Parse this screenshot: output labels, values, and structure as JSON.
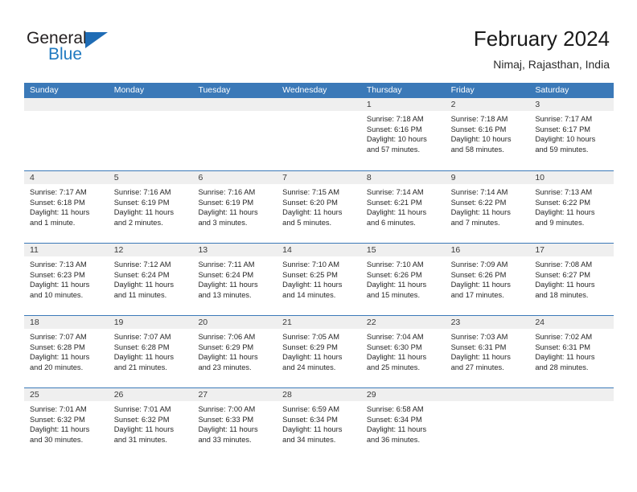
{
  "brand": {
    "line1": "General",
    "line2": "Blue",
    "triangle_color": "#1f6cb5",
    "blue_color": "#1f79c0"
  },
  "header": {
    "title": "February 2024",
    "location": "Nimaj, Rajasthan, India"
  },
  "theme": {
    "header_bg": "#3b79b8",
    "day_band_bg": "#efefef",
    "text": "#262626"
  },
  "calendar": {
    "weekday_headers": [
      "Sunday",
      "Monday",
      "Tuesday",
      "Wednesday",
      "Thursday",
      "Friday",
      "Saturday"
    ],
    "weeks": [
      [
        {
          "day": "",
          "empty": true
        },
        {
          "day": "",
          "empty": true
        },
        {
          "day": "",
          "empty": true
        },
        {
          "day": "",
          "empty": true
        },
        {
          "day": "1",
          "sunrise": "Sunrise: 7:18 AM",
          "sunset": "Sunset: 6:16 PM",
          "daylight1": "Daylight: 10 hours",
          "daylight2": "and 57 minutes."
        },
        {
          "day": "2",
          "sunrise": "Sunrise: 7:18 AM",
          "sunset": "Sunset: 6:16 PM",
          "daylight1": "Daylight: 10 hours",
          "daylight2": "and 58 minutes."
        },
        {
          "day": "3",
          "sunrise": "Sunrise: 7:17 AM",
          "sunset": "Sunset: 6:17 PM",
          "daylight1": "Daylight: 10 hours",
          "daylight2": "and 59 minutes."
        }
      ],
      [
        {
          "day": "4",
          "sunrise": "Sunrise: 7:17 AM",
          "sunset": "Sunset: 6:18 PM",
          "daylight1": "Daylight: 11 hours",
          "daylight2": "and 1 minute."
        },
        {
          "day": "5",
          "sunrise": "Sunrise: 7:16 AM",
          "sunset": "Sunset: 6:19 PM",
          "daylight1": "Daylight: 11 hours",
          "daylight2": "and 2 minutes."
        },
        {
          "day": "6",
          "sunrise": "Sunrise: 7:16 AM",
          "sunset": "Sunset: 6:19 PM",
          "daylight1": "Daylight: 11 hours",
          "daylight2": "and 3 minutes."
        },
        {
          "day": "7",
          "sunrise": "Sunrise: 7:15 AM",
          "sunset": "Sunset: 6:20 PM",
          "daylight1": "Daylight: 11 hours",
          "daylight2": "and 5 minutes."
        },
        {
          "day": "8",
          "sunrise": "Sunrise: 7:14 AM",
          "sunset": "Sunset: 6:21 PM",
          "daylight1": "Daylight: 11 hours",
          "daylight2": "and 6 minutes."
        },
        {
          "day": "9",
          "sunrise": "Sunrise: 7:14 AM",
          "sunset": "Sunset: 6:22 PM",
          "daylight1": "Daylight: 11 hours",
          "daylight2": "and 7 minutes."
        },
        {
          "day": "10",
          "sunrise": "Sunrise: 7:13 AM",
          "sunset": "Sunset: 6:22 PM",
          "daylight1": "Daylight: 11 hours",
          "daylight2": "and 9 minutes."
        }
      ],
      [
        {
          "day": "11",
          "sunrise": "Sunrise: 7:13 AM",
          "sunset": "Sunset: 6:23 PM",
          "daylight1": "Daylight: 11 hours",
          "daylight2": "and 10 minutes."
        },
        {
          "day": "12",
          "sunrise": "Sunrise: 7:12 AM",
          "sunset": "Sunset: 6:24 PM",
          "daylight1": "Daylight: 11 hours",
          "daylight2": "and 11 minutes."
        },
        {
          "day": "13",
          "sunrise": "Sunrise: 7:11 AM",
          "sunset": "Sunset: 6:24 PM",
          "daylight1": "Daylight: 11 hours",
          "daylight2": "and 13 minutes."
        },
        {
          "day": "14",
          "sunrise": "Sunrise: 7:10 AM",
          "sunset": "Sunset: 6:25 PM",
          "daylight1": "Daylight: 11 hours",
          "daylight2": "and 14 minutes."
        },
        {
          "day": "15",
          "sunrise": "Sunrise: 7:10 AM",
          "sunset": "Sunset: 6:26 PM",
          "daylight1": "Daylight: 11 hours",
          "daylight2": "and 15 minutes."
        },
        {
          "day": "16",
          "sunrise": "Sunrise: 7:09 AM",
          "sunset": "Sunset: 6:26 PM",
          "daylight1": "Daylight: 11 hours",
          "daylight2": "and 17 minutes."
        },
        {
          "day": "17",
          "sunrise": "Sunrise: 7:08 AM",
          "sunset": "Sunset: 6:27 PM",
          "daylight1": "Daylight: 11 hours",
          "daylight2": "and 18 minutes."
        }
      ],
      [
        {
          "day": "18",
          "sunrise": "Sunrise: 7:07 AM",
          "sunset": "Sunset: 6:28 PM",
          "daylight1": "Daylight: 11 hours",
          "daylight2": "and 20 minutes."
        },
        {
          "day": "19",
          "sunrise": "Sunrise: 7:07 AM",
          "sunset": "Sunset: 6:28 PM",
          "daylight1": "Daylight: 11 hours",
          "daylight2": "and 21 minutes."
        },
        {
          "day": "20",
          "sunrise": "Sunrise: 7:06 AM",
          "sunset": "Sunset: 6:29 PM",
          "daylight1": "Daylight: 11 hours",
          "daylight2": "and 23 minutes."
        },
        {
          "day": "21",
          "sunrise": "Sunrise: 7:05 AM",
          "sunset": "Sunset: 6:29 PM",
          "daylight1": "Daylight: 11 hours",
          "daylight2": "and 24 minutes."
        },
        {
          "day": "22",
          "sunrise": "Sunrise: 7:04 AM",
          "sunset": "Sunset: 6:30 PM",
          "daylight1": "Daylight: 11 hours",
          "daylight2": "and 25 minutes."
        },
        {
          "day": "23",
          "sunrise": "Sunrise: 7:03 AM",
          "sunset": "Sunset: 6:31 PM",
          "daylight1": "Daylight: 11 hours",
          "daylight2": "and 27 minutes."
        },
        {
          "day": "24",
          "sunrise": "Sunrise: 7:02 AM",
          "sunset": "Sunset: 6:31 PM",
          "daylight1": "Daylight: 11 hours",
          "daylight2": "and 28 minutes."
        }
      ],
      [
        {
          "day": "25",
          "sunrise": "Sunrise: 7:01 AM",
          "sunset": "Sunset: 6:32 PM",
          "daylight1": "Daylight: 11 hours",
          "daylight2": "and 30 minutes."
        },
        {
          "day": "26",
          "sunrise": "Sunrise: 7:01 AM",
          "sunset": "Sunset: 6:32 PM",
          "daylight1": "Daylight: 11 hours",
          "daylight2": "and 31 minutes."
        },
        {
          "day": "27",
          "sunrise": "Sunrise: 7:00 AM",
          "sunset": "Sunset: 6:33 PM",
          "daylight1": "Daylight: 11 hours",
          "daylight2": "and 33 minutes."
        },
        {
          "day": "28",
          "sunrise": "Sunrise: 6:59 AM",
          "sunset": "Sunset: 6:34 PM",
          "daylight1": "Daylight: 11 hours",
          "daylight2": "and 34 minutes."
        },
        {
          "day": "29",
          "sunrise": "Sunrise: 6:58 AM",
          "sunset": "Sunset: 6:34 PM",
          "daylight1": "Daylight: 11 hours",
          "daylight2": "and 36 minutes."
        },
        {
          "day": "",
          "empty": true
        },
        {
          "day": "",
          "empty": true
        }
      ]
    ]
  }
}
